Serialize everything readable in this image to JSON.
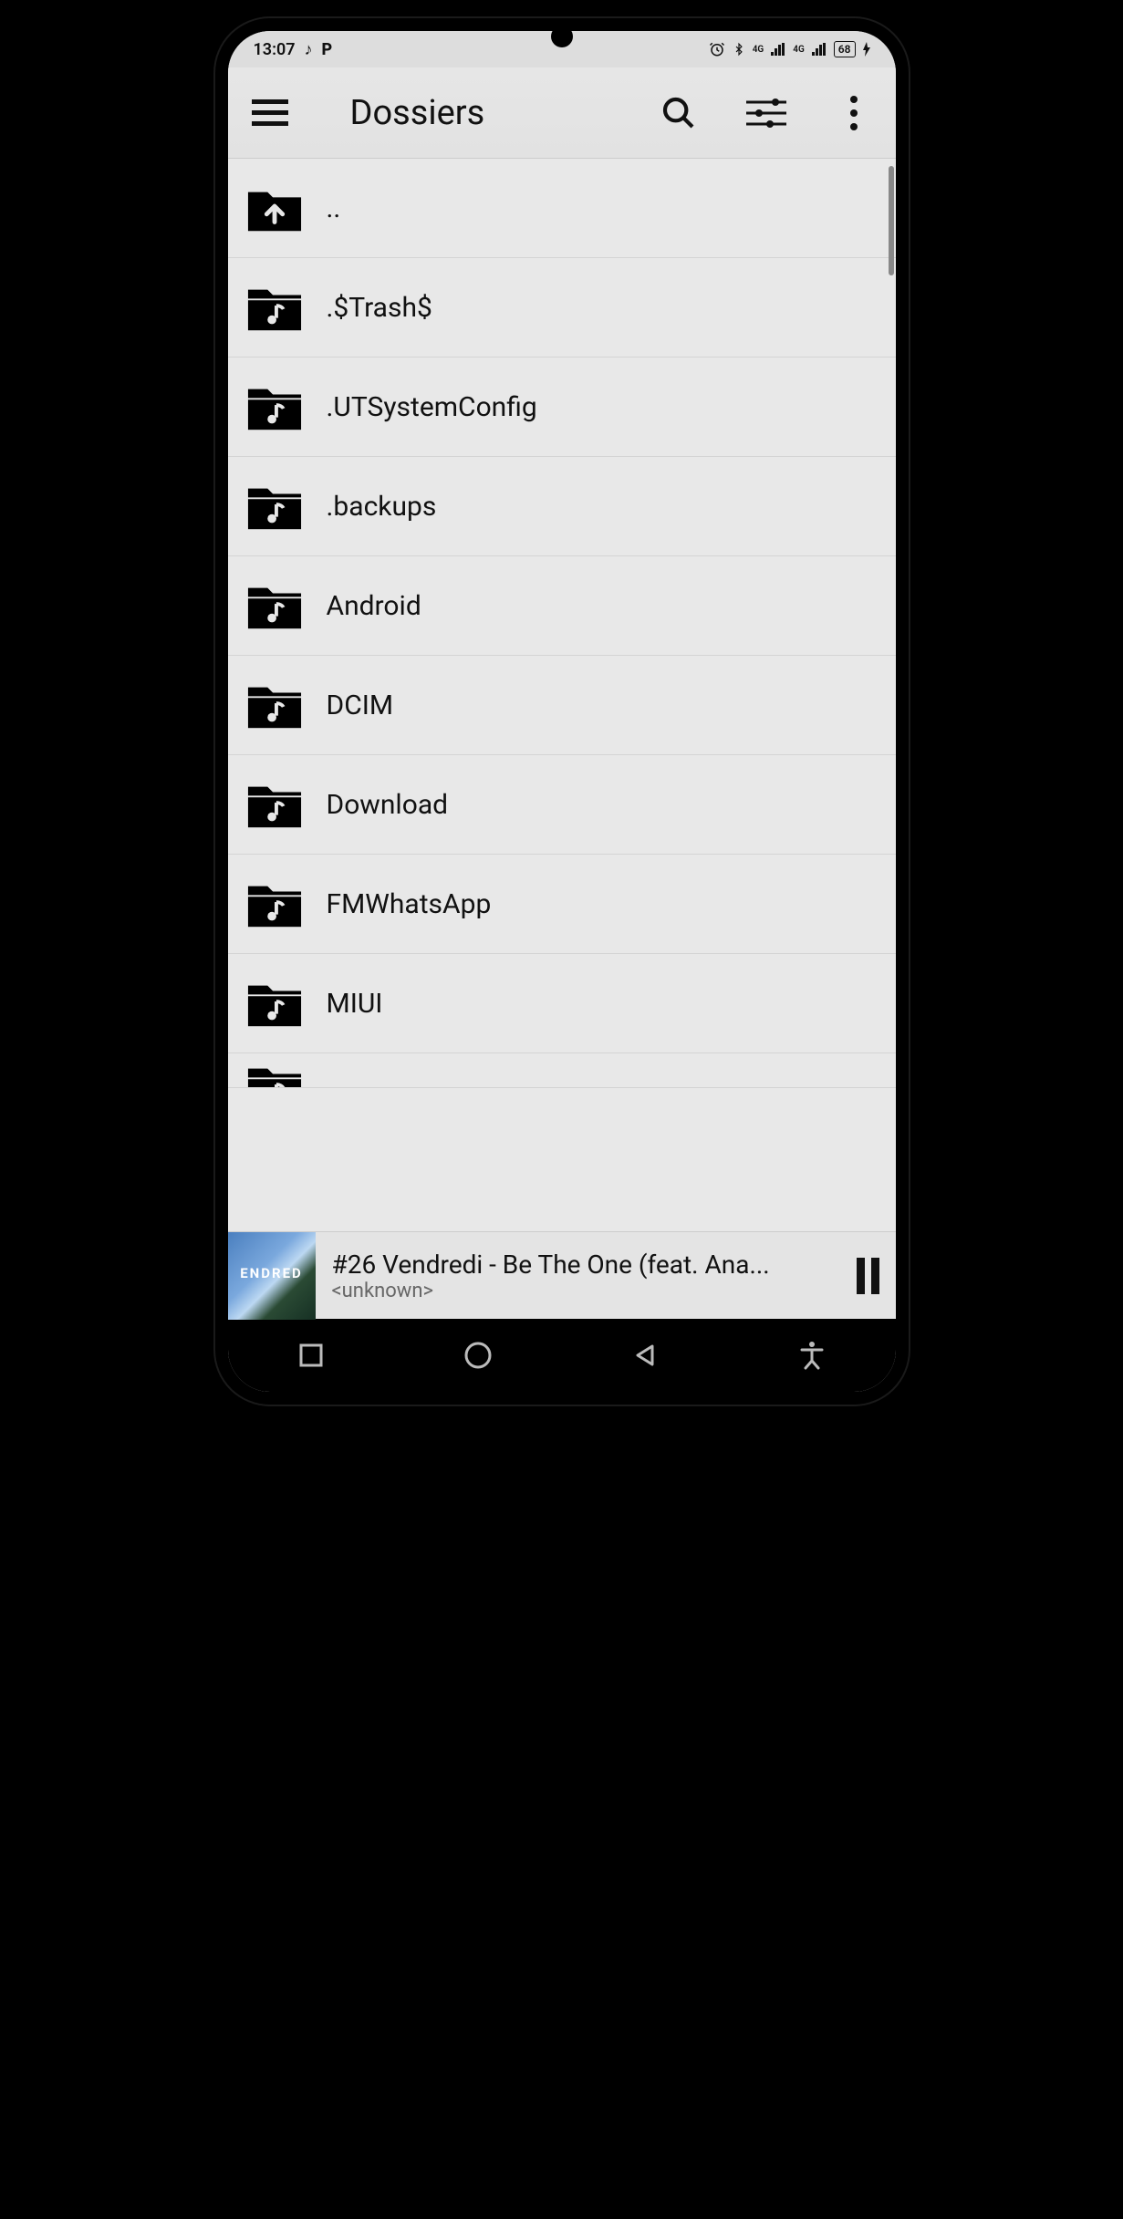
{
  "status": {
    "time": "13:07",
    "music_icon": "♪",
    "p_badge": "P",
    "alarm": true,
    "bluetooth": true,
    "net1": "4G",
    "net2": "4G",
    "battery": "68",
    "charging": true
  },
  "header": {
    "title": "Dossiers"
  },
  "folders": [
    {
      "label": "..",
      "type": "up"
    },
    {
      "label": ".$Trash$",
      "type": "music"
    },
    {
      "label": ".UTSystemConfig",
      "type": "music"
    },
    {
      "label": ".backups",
      "type": "music"
    },
    {
      "label": "Android",
      "type": "music"
    },
    {
      "label": "DCIM",
      "type": "music"
    },
    {
      "label": "Download",
      "type": "music"
    },
    {
      "label": "FMWhatsApp",
      "type": "music"
    },
    {
      "label": "MIUI",
      "type": "music"
    }
  ],
  "now_playing": {
    "title": "#26 Vendredi -  Be The One (feat. Ana...",
    "artist": "<unknown>",
    "art_label": "ENDRED",
    "state": "playing"
  }
}
